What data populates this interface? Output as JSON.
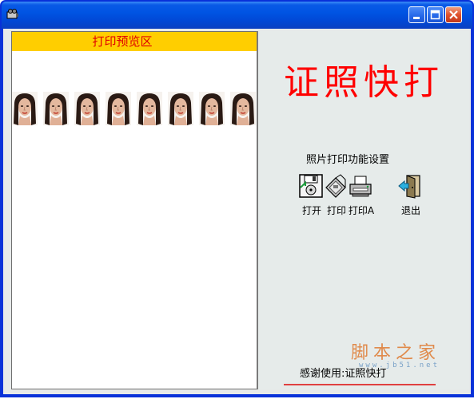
{
  "window": {
    "app_icon": "projector-icon"
  },
  "titlebar_buttons": [
    "minimize-icon",
    "maximize-icon",
    "close-icon"
  ],
  "preview": {
    "header": "打印预览区",
    "photo_count": 8
  },
  "brand": {
    "title": "证照快打"
  },
  "settings": {
    "label": "照片打印功能设置",
    "tools": [
      {
        "label": "打开",
        "icon": "open-disk-icon"
      },
      {
        "label": "打印",
        "icon": "printer-icon"
      },
      {
        "label": "打印A",
        "icon": "printer-a-icon"
      },
      {
        "label": "退出",
        "icon": "exit-door-icon"
      }
    ]
  },
  "watermark": {
    "text": "脚本之家",
    "url": "www.jb51.net"
  },
  "footer": {
    "thanks": "感谢使用:证照快打"
  },
  "colors": {
    "title_accent": "#ff0000",
    "preview_header_bg": "#ffce00",
    "titlebar": "#0054e3"
  }
}
